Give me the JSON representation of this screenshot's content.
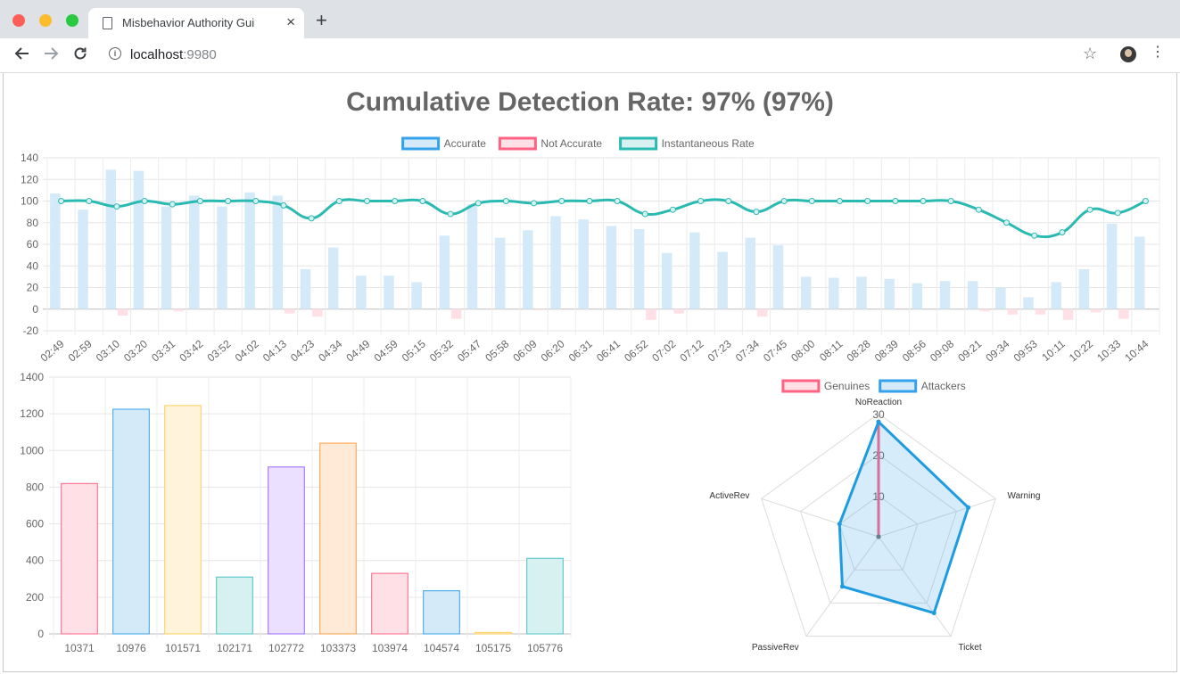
{
  "browser": {
    "tab_title": "Misbehavior Authority Gui",
    "tab_close": "×",
    "new_tab": "+",
    "url_host": "localhost",
    "url_port": ":9980",
    "back_icon": "arrow-left-icon",
    "forward_icon": "arrow-right-icon",
    "reload_icon": "reload-icon",
    "info_icon": "info-icon",
    "star_icon": "star-icon",
    "menu_icon": "kebab-menu-icon"
  },
  "page": {
    "title": "Cumulative Detection Rate: 97% (97%)"
  },
  "chart_data": [
    {
      "type": "bar",
      "legend": [
        {
          "label": "Accurate",
          "fill": "#d4eaf8",
          "stroke": "#36a2eb"
        },
        {
          "label": "Not Accurate",
          "fill": "#ffe0e6",
          "stroke": "#ff6384"
        },
        {
          "label": "Instantaneous Rate",
          "fill": "#d7f1f1",
          "stroke": "#2bbab2"
        }
      ],
      "legend_position": "top",
      "categories": [
        "02:49",
        "02:59",
        "03:10",
        "03:20",
        "03:31",
        "03:42",
        "03:52",
        "04:02",
        "04:13",
        "04:23",
        "04:34",
        "04:49",
        "04:59",
        "05:15",
        "05:32",
        "05:47",
        "05:58",
        "06:09",
        "06:20",
        "06:31",
        "06:41",
        "06:52",
        "07:02",
        "07:12",
        "07:23",
        "07:34",
        "07:45",
        "08:00",
        "08:11",
        "08:28",
        "08:39",
        "08:56",
        "09:08",
        "09:21",
        "09:34",
        "09:53",
        "10:11",
        "10:22",
        "10:33",
        "10:44"
      ],
      "series": [
        {
          "name": "Accurate",
          "values": [
            107,
            92,
            129,
            128,
            95,
            105,
            95,
            108,
            105,
            37,
            57,
            31,
            31,
            25,
            68,
            97,
            66,
            73,
            86,
            83,
            77,
            74,
            52,
            71,
            53,
            66,
            59,
            30,
            29,
            30,
            28,
            24,
            26,
            26,
            20,
            11,
            25,
            37,
            79,
            67
          ]
        },
        {
          "name": "Not Accurate",
          "values": [
            0,
            0,
            -6,
            0,
            -2,
            0,
            0,
            0,
            -4,
            -7,
            0,
            0,
            0,
            0,
            -9,
            0,
            0,
            -1,
            0,
            0,
            0,
            -10,
            -4,
            0,
            0,
            -7,
            0,
            0,
            0,
            0,
            0,
            0,
            0,
            -2,
            -5,
            -5,
            -10,
            -3,
            -9,
            0
          ]
        },
        {
          "name": "Instantaneous Rate",
          "values": [
            100,
            100,
            95,
            100,
            97,
            100,
            100,
            100,
            96,
            84,
            100,
            100,
            100,
            100,
            88,
            98,
            100,
            98,
            100,
            100,
            100,
            88,
            92,
            100,
            100,
            90,
            100,
            100,
            100,
            100,
            100,
            100,
            100,
            92,
            80,
            68,
            71,
            92,
            89,
            100
          ]
        }
      ],
      "ylim": [
        -20,
        140
      ],
      "yticks": [
        -20,
        0,
        20,
        40,
        60,
        80,
        100,
        120,
        140
      ],
      "grid": true
    },
    {
      "type": "bar",
      "categories": [
        "10371",
        "10976",
        "101571",
        "102171",
        "102772",
        "103373",
        "103974",
        "104574",
        "105175",
        "105776"
      ],
      "values": [
        820,
        1225,
        1245,
        310,
        910,
        1040,
        330,
        235,
        8,
        412
      ],
      "colors": [
        {
          "fill": "#ffe0e6",
          "stroke": "#ff6384"
        },
        {
          "fill": "#d4eaf8",
          "stroke": "#36a2eb"
        },
        {
          "fill": "#fff3dc",
          "stroke": "#ffce56"
        },
        {
          "fill": "#d7f1f1",
          "stroke": "#4bc0c0"
        },
        {
          "fill": "#ebe0ff",
          "stroke": "#9966ff"
        },
        {
          "fill": "#ffead7",
          "stroke": "#ff9f40"
        },
        {
          "fill": "#ffe0e6",
          "stroke": "#ff6384"
        },
        {
          "fill": "#d4eaf8",
          "stroke": "#36a2eb"
        },
        {
          "fill": "#fff3dc",
          "stroke": "#ffce56"
        },
        {
          "fill": "#d7f1f1",
          "stroke": "#4bc0c0"
        }
      ],
      "ylim": [
        0,
        1400
      ],
      "yticks": [
        0,
        200,
        400,
        600,
        800,
        1000,
        1200,
        1400
      ],
      "grid": true
    },
    {
      "type": "radar",
      "legend": [
        {
          "label": "Genuines",
          "fill": "#ffe0e6",
          "stroke": "#ff6384"
        },
        {
          "label": "Attackers",
          "fill": "#d4eaf8",
          "stroke": "#36a2eb"
        }
      ],
      "legend_position": "top",
      "axes": [
        "NoReaction",
        "Warning",
        "Ticket",
        "PassiveRev",
        "ActiveRev"
      ],
      "series": [
        {
          "name": "Genuines",
          "values": [
            28,
            0,
            0,
            0,
            0
          ]
        },
        {
          "name": "Attackers",
          "values": [
            28,
            23,
            23,
            15,
            10
          ]
        }
      ],
      "rlim": [
        0,
        30
      ],
      "rticks": [
        10,
        20,
        30
      ]
    }
  ]
}
